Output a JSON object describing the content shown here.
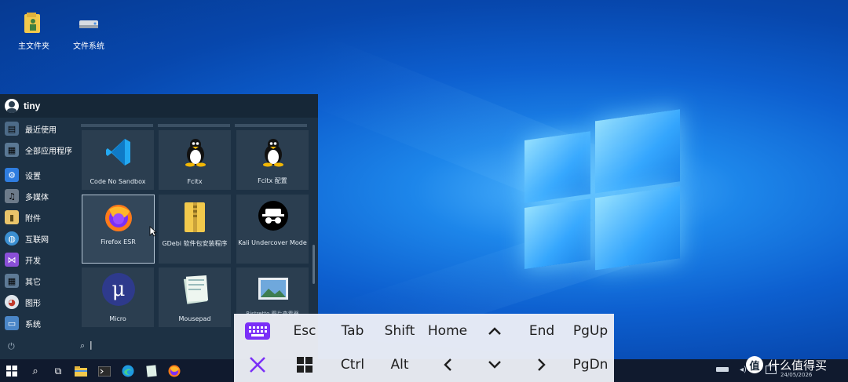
{
  "desktop": {
    "icons": [
      {
        "label": "主文件夹",
        "icon": "home-folder-icon"
      },
      {
        "label": "文件系统",
        "icon": "drive-icon"
      }
    ]
  },
  "start_menu": {
    "user_name": "tiny",
    "categories": [
      {
        "label": "最近使用",
        "icon": "recent-icon"
      },
      {
        "label": "全部应用程序",
        "icon": "all-apps-icon"
      },
      {
        "label": "设置",
        "icon": "settings-icon"
      },
      {
        "label": "多媒体",
        "icon": "multimedia-icon"
      },
      {
        "label": "附件",
        "icon": "accessories-icon"
      },
      {
        "label": "互联网",
        "icon": "internet-icon"
      },
      {
        "label": "开发",
        "icon": "development-icon"
      },
      {
        "label": "其它",
        "icon": "other-icon"
      },
      {
        "label": "图形",
        "icon": "graphics-icon"
      },
      {
        "label": "系统",
        "icon": "system-icon"
      }
    ],
    "tiles": [
      {
        "label": "Code No Sandbox",
        "icon": "vscode-icon"
      },
      {
        "label": "Fcitx",
        "icon": "tux-icon"
      },
      {
        "label": "Fcitx 配置",
        "icon": "tux-icon"
      },
      {
        "label": "Firefox ESR",
        "icon": "firefox-icon"
      },
      {
        "label": "GDebi 软件包安装程序",
        "icon": "archive-icon"
      },
      {
        "label": "Kali Undercover Mode",
        "icon": "undercover-icon"
      },
      {
        "label": "Micro",
        "icon": "micro-icon"
      },
      {
        "label": "Mousepad",
        "icon": "notepad-icon"
      },
      {
        "label": "Ristretto 图片查看器",
        "icon": "image-viewer-icon"
      }
    ],
    "search_prefix": "|"
  },
  "virtual_keyboard": {
    "row1": [
      "Esc",
      "Tab",
      "Shift",
      "Home",
      "^",
      "End",
      "PgUp"
    ],
    "row2": [
      "Ctrl",
      "Alt",
      "<",
      "v",
      ">",
      "PgDn"
    ],
    "accent_color": "#7b2ff7"
  },
  "taskbar": {
    "date": "24/05/2026"
  },
  "watermark": {
    "text": "什么值得买",
    "badge": "值"
  }
}
